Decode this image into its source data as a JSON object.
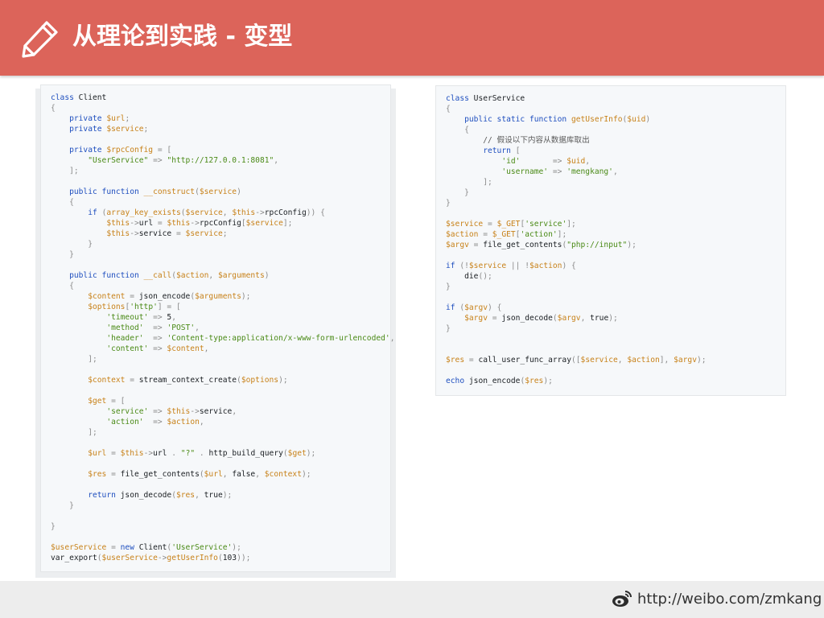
{
  "header": {
    "title": "从理论到实践 - 变型",
    "icon": "pencil-icon",
    "background": "#dc645a"
  },
  "code_left": {
    "lines": [
      [
        [
          "k",
          "class"
        ],
        [
          "n",
          " Client"
        ]
      ],
      [
        [
          "p",
          "{"
        ]
      ],
      [
        [
          "n",
          "    "
        ],
        [
          "k",
          "private"
        ],
        [
          "n",
          " "
        ],
        [
          "v",
          "$url"
        ],
        [
          "p",
          ";"
        ]
      ],
      [
        [
          "n",
          "    "
        ],
        [
          "k",
          "private"
        ],
        [
          "n",
          " "
        ],
        [
          "v",
          "$service"
        ],
        [
          "p",
          ";"
        ]
      ],
      [],
      [
        [
          "n",
          "    "
        ],
        [
          "k",
          "private"
        ],
        [
          "n",
          " "
        ],
        [
          "v",
          "$rpcConfig"
        ],
        [
          "n",
          " "
        ],
        [
          "p",
          "= ["
        ]
      ],
      [
        [
          "n",
          "        "
        ],
        [
          "s",
          "\"UserService\""
        ],
        [
          "n",
          " "
        ],
        [
          "p",
          "=>"
        ],
        [
          "n",
          " "
        ],
        [
          "s",
          "\"http://127.0.0.1:8081\""
        ],
        [
          "p",
          ","
        ]
      ],
      [
        [
          "n",
          "    "
        ],
        [
          "p",
          "];"
        ]
      ],
      [],
      [
        [
          "n",
          "    "
        ],
        [
          "k",
          "public function"
        ],
        [
          "n",
          " "
        ],
        [
          "v",
          "__construct"
        ],
        [
          "p",
          "("
        ],
        [
          "v",
          "$service"
        ],
        [
          "p",
          ")"
        ]
      ],
      [
        [
          "n",
          "    "
        ],
        [
          "p",
          "{"
        ]
      ],
      [
        [
          "n",
          "        "
        ],
        [
          "k",
          "if"
        ],
        [
          "n",
          " "
        ],
        [
          "p",
          "("
        ],
        [
          "v",
          "array_key_exists"
        ],
        [
          "p",
          "("
        ],
        [
          "v",
          "$service"
        ],
        [
          "p",
          ", "
        ],
        [
          "v",
          "$this"
        ],
        [
          "p",
          "->"
        ],
        [
          "n",
          "rpcConfig"
        ],
        [
          "p",
          ")) {"
        ]
      ],
      [
        [
          "n",
          "            "
        ],
        [
          "v",
          "$this"
        ],
        [
          "p",
          "->"
        ],
        [
          "n",
          "url"
        ],
        [
          "n",
          " "
        ],
        [
          "p",
          "="
        ],
        [
          "n",
          " "
        ],
        [
          "v",
          "$this"
        ],
        [
          "p",
          "->"
        ],
        [
          "n",
          "rpcConfig"
        ],
        [
          "p",
          "["
        ],
        [
          "v",
          "$service"
        ],
        [
          "p",
          "];"
        ]
      ],
      [
        [
          "n",
          "            "
        ],
        [
          "v",
          "$this"
        ],
        [
          "p",
          "->"
        ],
        [
          "n",
          "service"
        ],
        [
          "n",
          " "
        ],
        [
          "p",
          "="
        ],
        [
          "n",
          " "
        ],
        [
          "v",
          "$service"
        ],
        [
          "p",
          ";"
        ]
      ],
      [
        [
          "n",
          "        "
        ],
        [
          "p",
          "}"
        ]
      ],
      [
        [
          "n",
          "    "
        ],
        [
          "p",
          "}"
        ]
      ],
      [],
      [
        [
          "n",
          "    "
        ],
        [
          "k",
          "public function"
        ],
        [
          "n",
          " "
        ],
        [
          "v",
          "__call"
        ],
        [
          "p",
          "("
        ],
        [
          "v",
          "$action"
        ],
        [
          "p",
          ", "
        ],
        [
          "v",
          "$arguments"
        ],
        [
          "p",
          ")"
        ]
      ],
      [
        [
          "n",
          "    "
        ],
        [
          "p",
          "{"
        ]
      ],
      [
        [
          "n",
          "        "
        ],
        [
          "v",
          "$content"
        ],
        [
          "n",
          " "
        ],
        [
          "p",
          "="
        ],
        [
          "n",
          " "
        ],
        [
          "n",
          "json_encode"
        ],
        [
          "p",
          "("
        ],
        [
          "v",
          "$arguments"
        ],
        [
          "p",
          ");"
        ]
      ],
      [
        [
          "n",
          "        "
        ],
        [
          "v",
          "$options"
        ],
        [
          "p",
          "["
        ],
        [
          "s",
          "'http'"
        ],
        [
          "p",
          "] = ["
        ]
      ],
      [
        [
          "n",
          "            "
        ],
        [
          "s",
          "'timeout'"
        ],
        [
          "n",
          " "
        ],
        [
          "p",
          "=>"
        ],
        [
          "n",
          " 5"
        ],
        [
          "p",
          ","
        ]
      ],
      [
        [
          "n",
          "            "
        ],
        [
          "s",
          "'method'"
        ],
        [
          "n",
          "  "
        ],
        [
          "p",
          "=>"
        ],
        [
          "n",
          " "
        ],
        [
          "s",
          "'POST'"
        ],
        [
          "p",
          ","
        ]
      ],
      [
        [
          "n",
          "            "
        ],
        [
          "s",
          "'header'"
        ],
        [
          "n",
          "  "
        ],
        [
          "p",
          "=>"
        ],
        [
          "n",
          " "
        ],
        [
          "s",
          "'Content-type:application/x-www-form-urlencoded'"
        ],
        [
          "p",
          ","
        ]
      ],
      [
        [
          "n",
          "            "
        ],
        [
          "s",
          "'content'"
        ],
        [
          "n",
          " "
        ],
        [
          "p",
          "=>"
        ],
        [
          "n",
          " "
        ],
        [
          "v",
          "$content"
        ],
        [
          "p",
          ","
        ]
      ],
      [
        [
          "n",
          "        "
        ],
        [
          "p",
          "];"
        ]
      ],
      [],
      [
        [
          "n",
          "        "
        ],
        [
          "v",
          "$context"
        ],
        [
          "n",
          " "
        ],
        [
          "p",
          "="
        ],
        [
          "n",
          " "
        ],
        [
          "n",
          "stream_context_create"
        ],
        [
          "p",
          "("
        ],
        [
          "v",
          "$options"
        ],
        [
          "p",
          ");"
        ]
      ],
      [],
      [
        [
          "n",
          "        "
        ],
        [
          "v",
          "$get"
        ],
        [
          "n",
          " "
        ],
        [
          "p",
          "= ["
        ]
      ],
      [
        [
          "n",
          "            "
        ],
        [
          "s",
          "'service'"
        ],
        [
          "n",
          " "
        ],
        [
          "p",
          "=>"
        ],
        [
          "n",
          " "
        ],
        [
          "v",
          "$this"
        ],
        [
          "p",
          "->"
        ],
        [
          "n",
          "service"
        ],
        [
          "p",
          ","
        ]
      ],
      [
        [
          "n",
          "            "
        ],
        [
          "s",
          "'action'"
        ],
        [
          "n",
          "  "
        ],
        [
          "p",
          "=>"
        ],
        [
          "n",
          " "
        ],
        [
          "v",
          "$action"
        ],
        [
          "p",
          ","
        ]
      ],
      [
        [
          "n",
          "        "
        ],
        [
          "p",
          "];"
        ]
      ],
      [],
      [
        [
          "n",
          "        "
        ],
        [
          "v",
          "$url"
        ],
        [
          "n",
          " "
        ],
        [
          "p",
          "="
        ],
        [
          "n",
          " "
        ],
        [
          "v",
          "$this"
        ],
        [
          "p",
          "->"
        ],
        [
          "n",
          "url"
        ],
        [
          "n",
          " "
        ],
        [
          "p",
          "."
        ],
        [
          "n",
          " "
        ],
        [
          "s",
          "\"?\""
        ],
        [
          "n",
          " "
        ],
        [
          "p",
          "."
        ],
        [
          "n",
          " "
        ],
        [
          "n",
          "http_build_query"
        ],
        [
          "p",
          "("
        ],
        [
          "v",
          "$get"
        ],
        [
          "p",
          ");"
        ]
      ],
      [],
      [
        [
          "n",
          "        "
        ],
        [
          "v",
          "$res"
        ],
        [
          "n",
          " "
        ],
        [
          "p",
          "="
        ],
        [
          "n",
          " "
        ],
        [
          "n",
          "file_get_contents"
        ],
        [
          "p",
          "("
        ],
        [
          "v",
          "$url"
        ],
        [
          "p",
          ", "
        ],
        [
          "n",
          "false"
        ],
        [
          "p",
          ", "
        ],
        [
          "v",
          "$context"
        ],
        [
          "p",
          ");"
        ]
      ],
      [],
      [
        [
          "n",
          "        "
        ],
        [
          "k",
          "return"
        ],
        [
          "n",
          " "
        ],
        [
          "n",
          "json_decode"
        ],
        [
          "p",
          "("
        ],
        [
          "v",
          "$res"
        ],
        [
          "p",
          ", "
        ],
        [
          "n",
          "true"
        ],
        [
          "p",
          ");"
        ]
      ],
      [
        [
          "n",
          "    "
        ],
        [
          "p",
          "}"
        ]
      ],
      [],
      [
        [
          "p",
          "}"
        ]
      ],
      [],
      [
        [
          "v",
          "$userService"
        ],
        [
          "n",
          " "
        ],
        [
          "p",
          "="
        ],
        [
          "n",
          " "
        ],
        [
          "k",
          "new"
        ],
        [
          "n",
          " Client"
        ],
        [
          "p",
          "("
        ],
        [
          "s",
          "'UserService'"
        ],
        [
          "p",
          ");"
        ]
      ],
      [
        [
          "n",
          "var_export"
        ],
        [
          "p",
          "("
        ],
        [
          "v",
          "$userService"
        ],
        [
          "p",
          "->"
        ],
        [
          "v",
          "getUserInfo"
        ],
        [
          "p",
          "("
        ],
        [
          "n",
          "103"
        ],
        [
          "p",
          "));"
        ]
      ]
    ]
  },
  "code_right": {
    "lines": [
      [
        [
          "k",
          "class"
        ],
        [
          "n",
          " UserService"
        ]
      ],
      [
        [
          "p",
          "{"
        ]
      ],
      [
        [
          "n",
          "    "
        ],
        [
          "k",
          "public static function"
        ],
        [
          "n",
          " "
        ],
        [
          "v",
          "getUserInfo"
        ],
        [
          "p",
          "("
        ],
        [
          "v",
          "$uid"
        ],
        [
          "p",
          ")"
        ]
      ],
      [
        [
          "n",
          "    "
        ],
        [
          "p",
          "{"
        ]
      ],
      [
        [
          "n",
          "        "
        ],
        [
          "c",
          "// 假设以下内容从数据库取出"
        ]
      ],
      [
        [
          "n",
          "        "
        ],
        [
          "k",
          "return"
        ],
        [
          "n",
          " "
        ],
        [
          "p",
          "["
        ]
      ],
      [
        [
          "n",
          "            "
        ],
        [
          "s",
          "'id'"
        ],
        [
          "n",
          "       "
        ],
        [
          "p",
          "=>"
        ],
        [
          "n",
          " "
        ],
        [
          "v",
          "$uid"
        ],
        [
          "p",
          ","
        ]
      ],
      [
        [
          "n",
          "            "
        ],
        [
          "s",
          "'username'"
        ],
        [
          "n",
          " "
        ],
        [
          "p",
          "=>"
        ],
        [
          "n",
          " "
        ],
        [
          "s",
          "'mengkang'"
        ],
        [
          "p",
          ","
        ]
      ],
      [
        [
          "n",
          "        "
        ],
        [
          "p",
          "];"
        ]
      ],
      [
        [
          "n",
          "    "
        ],
        [
          "p",
          "}"
        ]
      ],
      [
        [
          "p",
          "}"
        ]
      ],
      [],
      [
        [
          "v",
          "$service"
        ],
        [
          "n",
          " "
        ],
        [
          "p",
          "="
        ],
        [
          "n",
          " "
        ],
        [
          "v",
          "$_GET"
        ],
        [
          "p",
          "["
        ],
        [
          "s",
          "'service'"
        ],
        [
          "p",
          "];"
        ]
      ],
      [
        [
          "v",
          "$action"
        ],
        [
          "n",
          " "
        ],
        [
          "p",
          "="
        ],
        [
          "n",
          " "
        ],
        [
          "v",
          "$_GET"
        ],
        [
          "p",
          "["
        ],
        [
          "s",
          "'action'"
        ],
        [
          "p",
          "];"
        ]
      ],
      [
        [
          "v",
          "$argv"
        ],
        [
          "n",
          " "
        ],
        [
          "p",
          "="
        ],
        [
          "n",
          " "
        ],
        [
          "n",
          "file_get_contents"
        ],
        [
          "p",
          "("
        ],
        [
          "s",
          "\"php://input\""
        ],
        [
          "p",
          ");"
        ]
      ],
      [],
      [
        [
          "k",
          "if"
        ],
        [
          "n",
          " "
        ],
        [
          "p",
          "(!"
        ],
        [
          "v",
          "$service"
        ],
        [
          "n",
          " "
        ],
        [
          "p",
          "||"
        ],
        [
          "n",
          " "
        ],
        [
          "p",
          "!"
        ],
        [
          "v",
          "$action"
        ],
        [
          "p",
          ") {"
        ]
      ],
      [
        [
          "n",
          "    "
        ],
        [
          "n",
          "die"
        ],
        [
          "p",
          "();"
        ]
      ],
      [
        [
          "p",
          "}"
        ]
      ],
      [],
      [
        [
          "k",
          "if"
        ],
        [
          "n",
          " "
        ],
        [
          "p",
          "("
        ],
        [
          "v",
          "$argv"
        ],
        [
          "p",
          ") {"
        ]
      ],
      [
        [
          "n",
          "    "
        ],
        [
          "v",
          "$argv"
        ],
        [
          "n",
          " "
        ],
        [
          "p",
          "="
        ],
        [
          "n",
          " "
        ],
        [
          "n",
          "json_decode"
        ],
        [
          "p",
          "("
        ],
        [
          "v",
          "$argv"
        ],
        [
          "p",
          ", "
        ],
        [
          "n",
          "true"
        ],
        [
          "p",
          ");"
        ]
      ],
      [
        [
          "p",
          "}"
        ]
      ],
      [],
      [],
      [
        [
          "v",
          "$res"
        ],
        [
          "n",
          " "
        ],
        [
          "p",
          "="
        ],
        [
          "n",
          " "
        ],
        [
          "n",
          "call_user_func_array"
        ],
        [
          "p",
          "(["
        ],
        [
          "v",
          "$service"
        ],
        [
          "p",
          ", "
        ],
        [
          "v",
          "$action"
        ],
        [
          "p",
          "], "
        ],
        [
          "v",
          "$argv"
        ],
        [
          "p",
          ");"
        ]
      ],
      [],
      [
        [
          "k",
          "echo"
        ],
        [
          "n",
          " "
        ],
        [
          "n",
          "json_encode"
        ],
        [
          "p",
          "("
        ],
        [
          "v",
          "$res"
        ],
        [
          "p",
          ");"
        ]
      ]
    ]
  },
  "footer": {
    "link": "http://weibo.com/zmkang",
    "icon": "weibo-icon"
  }
}
